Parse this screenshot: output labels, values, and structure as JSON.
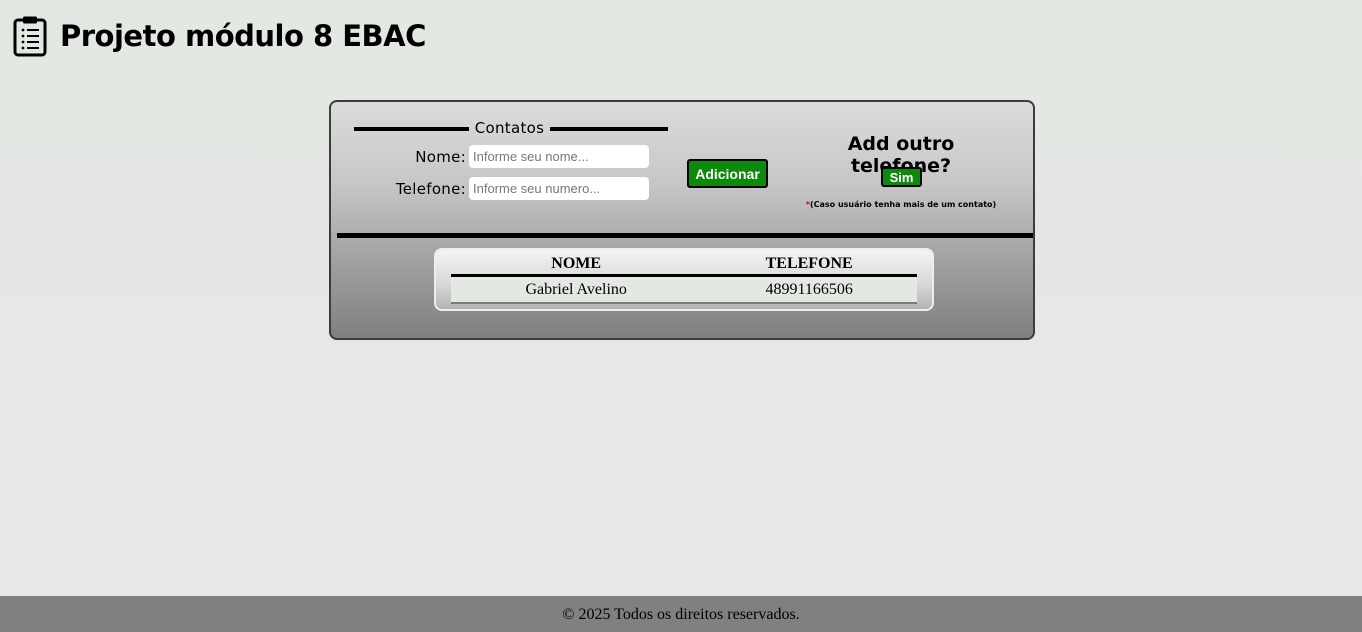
{
  "header": {
    "icon": "clipboard-list-icon",
    "title": "Projeto módulo 8 EBAC"
  },
  "form": {
    "legend": "Contatos",
    "nome_label": "Nome:",
    "nome_placeholder": "Informe seu nome...",
    "nome_value": "",
    "telefone_label": "Telefone:",
    "telefone_placeholder": "Informe seu numero...",
    "telefone_value": "",
    "add_button_label": "Adicionar"
  },
  "extra_phone": {
    "title": "Add outro telefone?",
    "button_label": "Sim",
    "note_marker": "*",
    "note_text": "(Caso usuário tenha mais de um contato)"
  },
  "table": {
    "headers": [
      "NOME",
      "TELEFONE"
    ],
    "rows": [
      {
        "nome": "Gabriel Avelino",
        "telefone": "48991166506"
      }
    ]
  },
  "footer": {
    "text": "© 2025 Todos os direitos reservados."
  },
  "colors": {
    "button_green": "#0b8a0b",
    "required_marker": "#e00000",
    "footer_bg": "#808080"
  }
}
